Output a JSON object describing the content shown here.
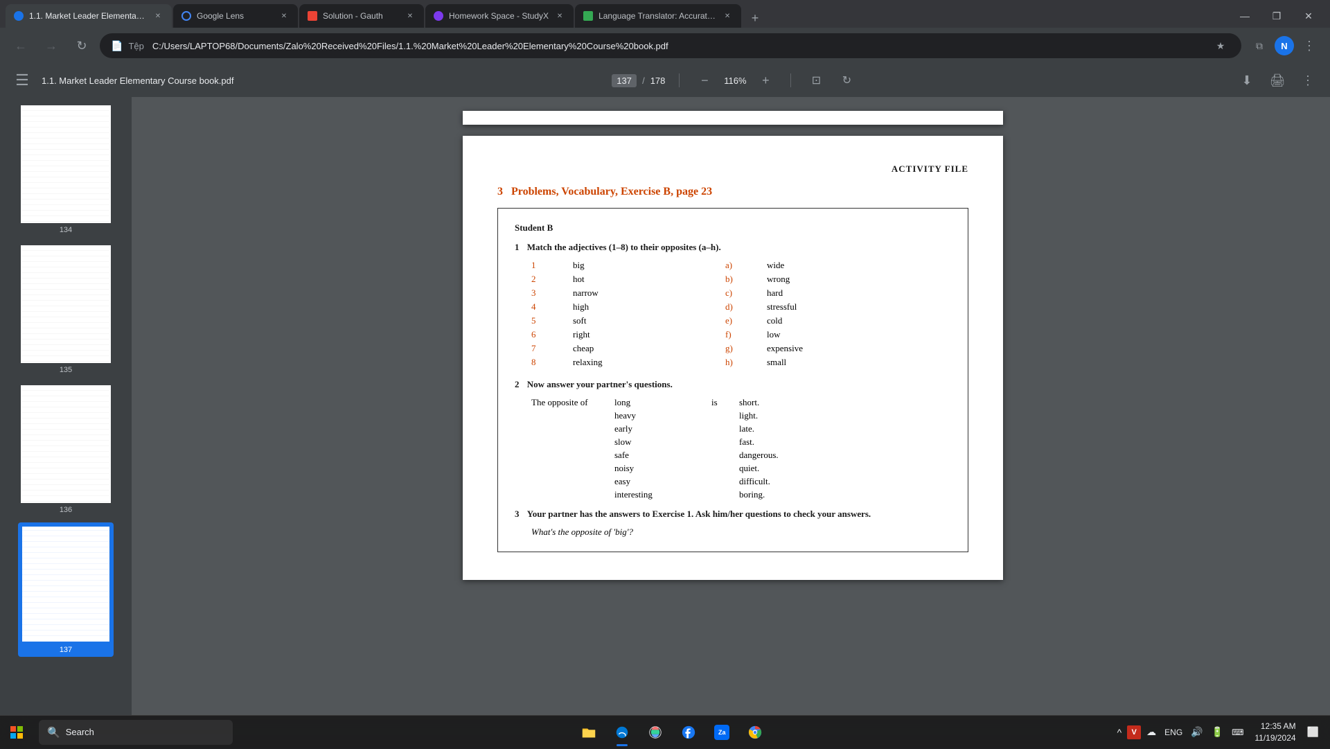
{
  "browser": {
    "tabs": [
      {
        "id": "tab1",
        "title": "1.1. Market Leader Elementary ...",
        "favicon_type": "blue",
        "active": true
      },
      {
        "id": "tab2",
        "title": "Google Lens",
        "favicon_type": "lens",
        "active": false
      },
      {
        "id": "tab3",
        "title": "Solution - Gauth",
        "favicon_type": "red",
        "active": false
      },
      {
        "id": "tab4",
        "title": "Homework Space - StudyX",
        "favicon_type": "purple",
        "active": false
      },
      {
        "id": "tab5",
        "title": "Language Translator: Accurate ...",
        "favicon_type": "green",
        "active": false
      }
    ],
    "address": "C:/Users/LAPTOP68/Documents/Zalo%20Received%20Files/1.1.%20Market%20Leader%20Elementary%20Course%20book.pdf",
    "address_prefix": "Tệp",
    "window_controls": [
      "—",
      "❐",
      "✕"
    ]
  },
  "pdf": {
    "title": "1.1. Market Leader Elementary Course book.pdf",
    "page_current": "137",
    "page_total": "178",
    "zoom": "116%",
    "toolbar_buttons": [
      "download",
      "print",
      "more"
    ]
  },
  "page_content": {
    "activity_file_label": "ACTIVITY FILE",
    "section_num": "3",
    "section_title": "Problems, Vocabulary, Exercise B, page 23",
    "student_b": "Student B",
    "exercise1": {
      "num": "1",
      "instruction": "Match the adjectives (1–8) to their opposites (a–h).",
      "words": [
        {
          "num": "1",
          "word": "big",
          "letter": "a)",
          "opposite": "wide"
        },
        {
          "num": "2",
          "word": "hot",
          "letter": "b)",
          "opposite": "wrong"
        },
        {
          "num": "3",
          "word": "narrow",
          "letter": "c)",
          "opposite": "hard"
        },
        {
          "num": "4",
          "word": "high",
          "letter": "d)",
          "opposite": "stressful"
        },
        {
          "num": "5",
          "word": "soft",
          "letter": "e)",
          "opposite": "cold"
        },
        {
          "num": "6",
          "word": "right",
          "letter": "f)",
          "opposite": "low"
        },
        {
          "num": "7",
          "word": "cheap",
          "letter": "g)",
          "opposite": "expensive"
        },
        {
          "num": "8",
          "word": "relaxing",
          "letter": "h)",
          "opposite": "small"
        }
      ]
    },
    "exercise2": {
      "num": "2",
      "instruction": "Now answer your partner's questions.",
      "prefix": "The opposite of",
      "pairs": [
        {
          "word": "long",
          "is": "is",
          "answer": "short."
        },
        {
          "word": "heavy",
          "is": "",
          "answer": "light."
        },
        {
          "word": "early",
          "is": "",
          "answer": "late."
        },
        {
          "word": "slow",
          "is": "",
          "answer": "fast."
        },
        {
          "word": "safe",
          "is": "",
          "answer": "dangerous."
        },
        {
          "word": "noisy",
          "is": "",
          "answer": "quiet."
        },
        {
          "word": "easy",
          "is": "",
          "answer": "difficult."
        },
        {
          "word": "interesting",
          "is": "",
          "answer": "boring."
        }
      ]
    },
    "exercise3": {
      "num": "3",
      "instruction": "Your partner has the answers to Exercise 1. Ask him/her questions to check your answers.",
      "example": "What's the opposite of 'big'?"
    }
  },
  "thumbnails": [
    {
      "num": "134",
      "active": false
    },
    {
      "num": "135",
      "active": false
    },
    {
      "num": "136",
      "active": false
    },
    {
      "num": "137",
      "active": true
    }
  ],
  "taskbar": {
    "search_text": "Search",
    "clock_time": "12:35 AM",
    "clock_date": "11/19/2024",
    "system_icons": [
      "chevron-up",
      "antivirus",
      "cloud",
      "lang",
      "speaker",
      "battery",
      "keyboard",
      "notifications"
    ]
  }
}
